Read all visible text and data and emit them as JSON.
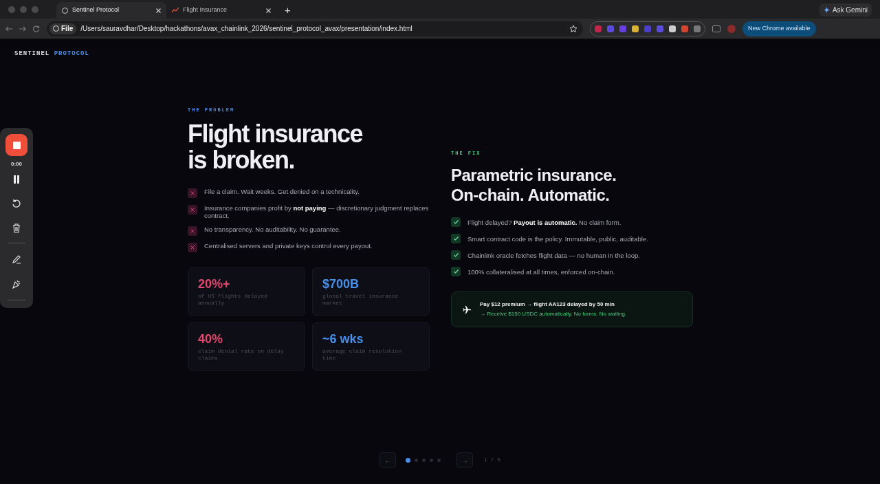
{
  "browser": {
    "tabs": [
      {
        "title": "Sentinel Protocol",
        "selected": true
      },
      {
        "title": "Flight Insurance",
        "selected": false
      }
    ],
    "new_tab": "+",
    "ask_gemini": "Ask Gemini",
    "address": {
      "badge": "File",
      "url": "/Users/sauravdhar/Desktop/hackathons/avax_chainlink_2026/sentinel_protocol_avax/presentation/index.html"
    },
    "extensions": [
      {
        "color": "#c0264a"
      },
      {
        "color": "#5b4bdb"
      },
      {
        "color": "#6a3fe0"
      },
      {
        "color": "#d9b233"
      },
      {
        "color": "#4b3fc9"
      },
      {
        "color": "#5b4bdb"
      },
      {
        "color": "#cccccc"
      },
      {
        "color": "#d2452f"
      },
      {
        "color": "#777777"
      }
    ],
    "update_button": "New Chrome available"
  },
  "recorder": {
    "time": "0:00"
  },
  "brand": {
    "first": "SENTINEL",
    "second": "PROTOCOL"
  },
  "problem": {
    "eyebrow": "THE PROBLEM",
    "title": [
      "Flight insurance",
      "is broken."
    ],
    "items": [
      "File a claim. Wait weeks. Get denied on a technicality.",
      "Insurance companies profit by **not paying** — discretionary judgment replaces contract.",
      "No transparency. No auditability. No guarantee.",
      "Centralised servers and private keys control every payout."
    ],
    "stats": [
      {
        "value": "20%+",
        "label": "of US flights delayed annually",
        "color": "#e0486e"
      },
      {
        "value": "$700B",
        "label": "global travel insurance market",
        "color": "#4a90e8"
      },
      {
        "value": "40%",
        "label": "claim denial rate on delay claims",
        "color": "#e0486e"
      },
      {
        "value": "~6 wks",
        "label": "average claim resolution time",
        "color": "#4a90e8"
      }
    ]
  },
  "fix": {
    "eyebrow": "THE FIX",
    "title": [
      "Parametric insurance.",
      "On-chain. Automatic."
    ],
    "items": [
      "Flight delayed? **Payout is automatic.** No claim form.",
      "Smart contract code is the policy. Immutable, public, auditable.",
      "Chainlink oracle fetches flight data — no human in the loop.",
      "100% collateralised at all times, enforced on-chain."
    ],
    "example": {
      "line1": "Pay $12 premium → flight AA123 delayed by 50 min",
      "line2": "→ Receive $150 USDC automatically. No forms. No waiting."
    }
  },
  "pager": {
    "prev": "←",
    "next": "→",
    "dots": [
      {
        "selected": true
      },
      {
        "selected": false
      },
      {
        "selected": false
      },
      {
        "selected": false
      },
      {
        "selected": false
      }
    ],
    "counter": "1 / 5"
  }
}
